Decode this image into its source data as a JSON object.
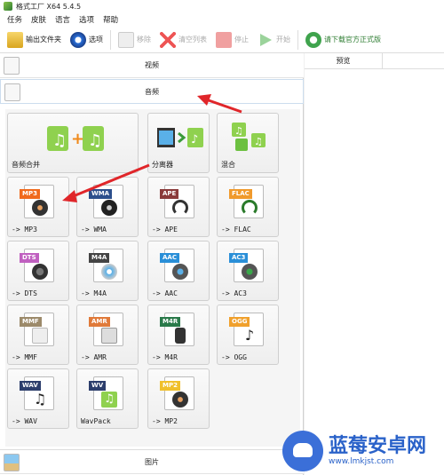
{
  "window": {
    "title": "格式工厂 X64 5.4.5"
  },
  "menu": [
    "任务",
    "皮肤",
    "语言",
    "选项",
    "帮助"
  ],
  "toolbar": {
    "output_folder": "输出文件夹",
    "options": "选项",
    "remove": "移除",
    "clear_list": "清空列表",
    "stop": "停止",
    "start": "开始",
    "download_official": "请下载官方正式版"
  },
  "categories": {
    "video": "视频",
    "audio": "音频",
    "image": "图片"
  },
  "audio_tools": {
    "merge": "音频合并",
    "splitter": "分离器",
    "mix": "混合"
  },
  "formats": [
    {
      "tag": "MP3",
      "label": "-> MP3",
      "color": "#f06a1d"
    },
    {
      "tag": "WMA",
      "label": "-> WMA",
      "color": "#2c4f8c"
    },
    {
      "tag": "APE",
      "label": "-> APE",
      "color": "#8a3a3a"
    },
    {
      "tag": "FLAC",
      "label": "-> FLAC",
      "color": "#f09a2c"
    },
    {
      "tag": "DTS",
      "label": "-> DTS",
      "color": "#c060c0"
    },
    {
      "tag": "M4A",
      "label": "-> M4A",
      "color": "#444444"
    },
    {
      "tag": "AAC",
      "label": "-> AAC",
      "color": "#2a8fd8"
    },
    {
      "tag": "AC3",
      "label": "-> AC3",
      "color": "#2a8fd8"
    },
    {
      "tag": "MMF",
      "label": "-> MMF",
      "color": "#9c8a6a"
    },
    {
      "tag": "AMR",
      "label": "-> AMR",
      "color": "#e07a3a"
    },
    {
      "tag": "M4R",
      "label": "-> M4R",
      "color": "#2a7a4a"
    },
    {
      "tag": "OGG",
      "label": "-> OGG",
      "color": "#f0a02c"
    },
    {
      "tag": "WAV",
      "label": "-> WAV",
      "color": "#2c3e6c"
    },
    {
      "tag": "WV",
      "label": "WavPack",
      "color": "#2c3e6c"
    },
    {
      "tag": "MP2",
      "label": "-> MP2",
      "color": "#f0c02c"
    }
  ],
  "preview": {
    "header": "预览"
  },
  "watermark": {
    "title": "蓝莓安卓网",
    "url": "www.lmkjst.com"
  },
  "colors": {
    "annotation_arrow": "#e0262a",
    "accent_green": "#2e7d32"
  }
}
